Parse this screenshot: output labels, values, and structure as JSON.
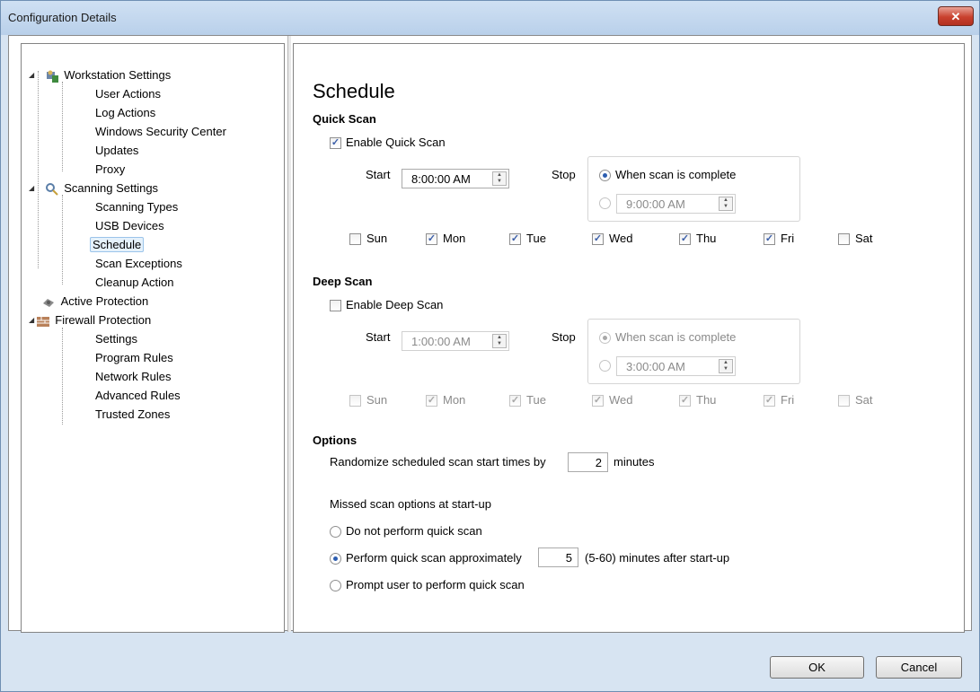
{
  "window": {
    "title": "Configuration Details",
    "close_label": "✕"
  },
  "tree": {
    "workstation": "Workstation Settings",
    "user_actions": "User Actions",
    "log_actions": "Log Actions",
    "wsc": "Windows Security Center",
    "updates": "Updates",
    "proxy": "Proxy",
    "scanning": "Scanning Settings",
    "scanning_types": "Scanning Types",
    "usb": "USB Devices",
    "schedule": "Schedule",
    "scan_exceptions": "Scan Exceptions",
    "cleanup": "Cleanup Action",
    "active_protection": "Active Protection",
    "firewall": "Firewall Protection",
    "fw_settings": "Settings",
    "program_rules": "Program Rules",
    "network_rules": "Network Rules",
    "advanced_rules": "Advanced Rules",
    "trusted_zones": "Trusted Zones"
  },
  "page": {
    "title": "Schedule"
  },
  "quick": {
    "heading": "Quick Scan",
    "enable_label": "Enable Quick Scan",
    "start_label": "Start",
    "start_value": "8:00:00 AM",
    "stop_label": "Stop",
    "when_complete": "When scan is complete",
    "stop_time": "9:00:00 AM"
  },
  "deep": {
    "heading": "Deep Scan",
    "enable_label": "Enable Deep Scan",
    "start_label": "Start",
    "start_value": "1:00:00 AM",
    "stop_label": "Stop",
    "when_complete": "When scan is complete",
    "stop_time": "3:00:00 AM"
  },
  "days": {
    "sun": "Sun",
    "mon": "Mon",
    "tue": "Tue",
    "wed": "Wed",
    "thu": "Thu",
    "fri": "Fri",
    "sat": "Sat"
  },
  "options": {
    "heading": "Options",
    "randomize_label": "Randomize scheduled scan start times by",
    "randomize_value": "2",
    "minutes": "minutes",
    "missed_label": "Missed scan options at start-up",
    "no_quick": "Do not perform quick scan",
    "perform_quick": "Perform quick scan approximately",
    "perform_value": "5",
    "perform_suffix": "(5-60) minutes after start-up",
    "prompt": "Prompt user to perform quick scan"
  },
  "buttons": {
    "ok": "OK",
    "cancel": "Cancel"
  }
}
